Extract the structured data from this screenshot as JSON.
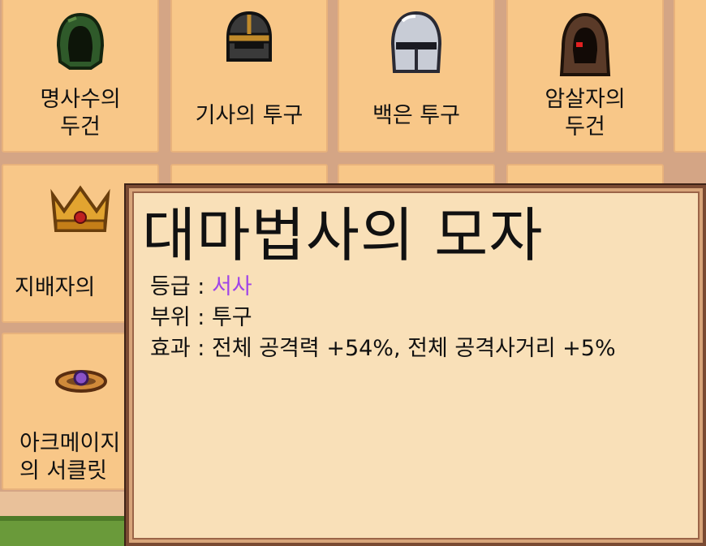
{
  "items": [
    {
      "name": "명사수의\n두건",
      "icon": "green-hood-icon"
    },
    {
      "name": "기사의 투구",
      "icon": "dark-helmet-icon"
    },
    {
      "name": "백은 투구",
      "icon": "silver-helmet-icon"
    },
    {
      "name": "암살자의\n두건",
      "icon": "brown-hood-icon"
    },
    {
      "name": "지배자의 ",
      "icon": "gold-crown-icon"
    },
    {
      "name": "아크메이지\n의 서클릿",
      "icon": "circlet-icon"
    }
  ],
  "tooltip": {
    "title": "대마법사의 모자",
    "grade_label": "등급 : ",
    "grade_value": "서사",
    "part_label": "부위 : ",
    "part_value": "투구",
    "effect_label": "효과 : ",
    "effect_value": "전체 공격력 +54%, 전체 공격사거리 +5%"
  },
  "colors": {
    "grade_epic": "#a045e8",
    "cell_bg": "#f8c788",
    "tooltip_bg": "#f9e0b8"
  }
}
